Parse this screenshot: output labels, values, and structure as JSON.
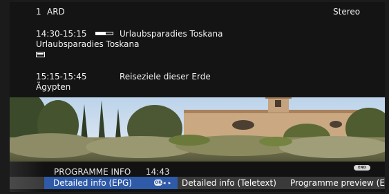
{
  "channel": {
    "number": "1",
    "name": "ARD",
    "audio": "Stereo"
  },
  "programmes": [
    {
      "time": "14:30-15:15",
      "title": "Urlaubsparadies Toskana",
      "subtitle": "Urlaubsparadies Toskana",
      "progress": 0.6
    },
    {
      "time": "15:15-15:45",
      "title": "Reiseziele dieser Erde",
      "subtitle": "Ägypten"
    }
  ],
  "bottom_bar": {
    "heading": "PROGRAMME INFO",
    "clock": "14:43",
    "end_key": "END",
    "ok_key": "OK",
    "nav_arrows": "◂ ▸",
    "menu": [
      {
        "label": "Detailed info (EPG)",
        "selected": true
      },
      {
        "label": "Detailed info (Teletext)",
        "selected": false
      },
      {
        "label": "Programme preview (E",
        "selected": false
      }
    ]
  },
  "colors": {
    "selection": "#2e5aa8",
    "panel": "#141414",
    "menu_row": "#3a3a3a"
  },
  "icons": [
    "progress-bar-icon",
    "programme-info-icon",
    "end-key-icon",
    "ok-key-icon",
    "left-right-arrows-icon"
  ]
}
